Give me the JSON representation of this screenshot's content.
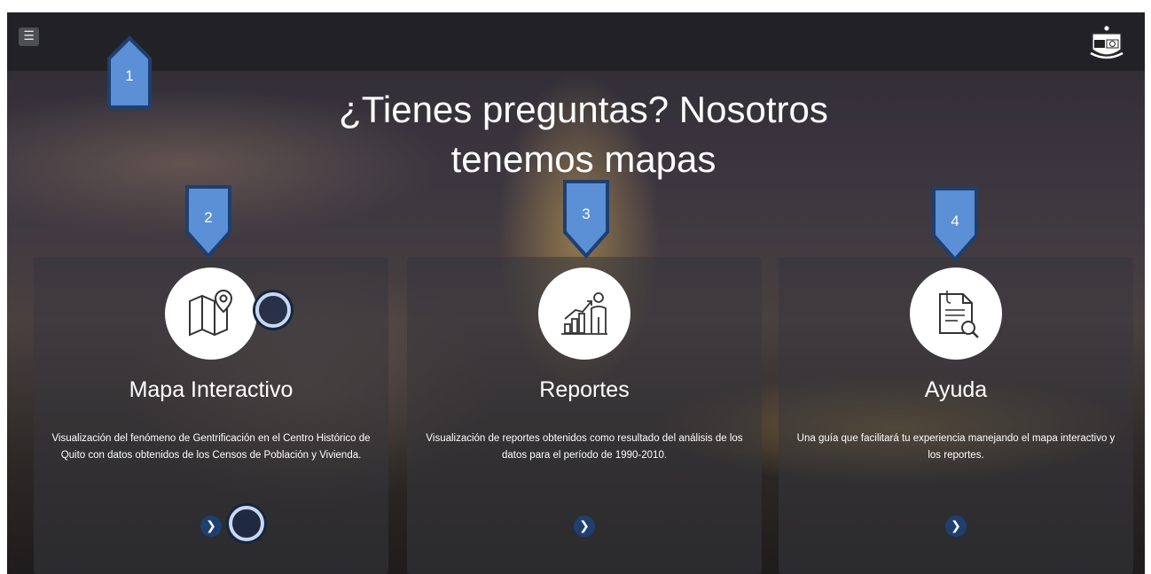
{
  "navbar": {
    "menu_icon": "hamburger-menu-icon",
    "logo_icon": "university-seal-logo"
  },
  "hero": {
    "title_line1": "¿Tienes preguntas? Nosotros",
    "title_line2": "tenemos mapas"
  },
  "cards": [
    {
      "icon": "map-pin-icon",
      "title": "Mapa Interactivo",
      "description": "Visualización del fenómeno de Gentrificación en el Centro Histórico de Quito con datos obtenidos de los Censos de Población y Vivienda.",
      "arrow_icon": "chevron-right-icon"
    },
    {
      "icon": "growth-chart-icon",
      "title": "Reportes",
      "description": "Visualización de reportes obtenidos como resultado del análisis de los datos para el período de 1990-2010.",
      "arrow_icon": "chevron-right-icon"
    },
    {
      "icon": "document-search-icon",
      "title": "Ayuda",
      "description": "Una guía que facilitará tu experiencia manejando el mapa interactivo y los reportes.",
      "arrow_icon": "chevron-right-icon"
    }
  ],
  "callouts": [
    "1",
    "2",
    "3",
    "4"
  ],
  "colors": {
    "navbar": "#222226",
    "callout_fill": "#5b8fd6",
    "callout_border": "#1f3f70",
    "arrow_button": "#1f3f70"
  }
}
